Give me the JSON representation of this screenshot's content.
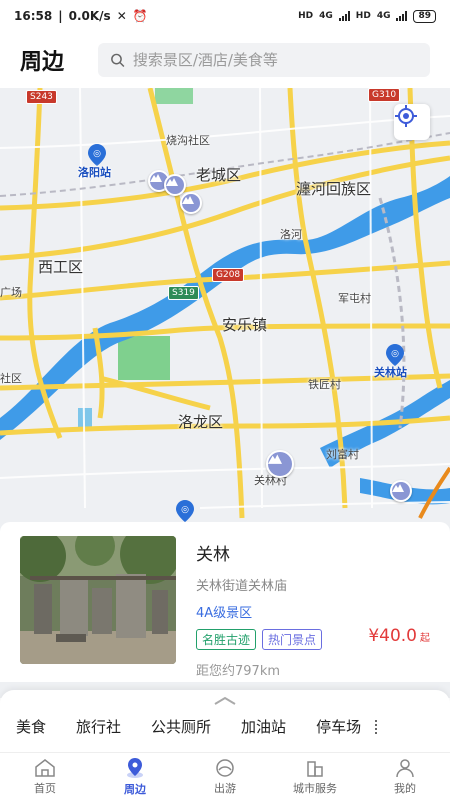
{
  "status": {
    "time": "16:58",
    "net": "0.0K/s",
    "battery": "89",
    "hd1": "HD",
    "hd2": "HD",
    "g1": "4G",
    "g2": "4G"
  },
  "header": {
    "title": "周边",
    "search_placeholder": "搜索景区/酒店/美食等"
  },
  "map": {
    "labels": {
      "laocheng": "老城区",
      "chanhe": "瀍河回族区",
      "xigong": "西工区",
      "anle": "安乐镇",
      "luolong": "洛龙区",
      "shaogou": "烧沟社区",
      "luohe": "洛河",
      "juntun": "军屯村",
      "tiejiang": "铁匠村",
      "liufu": "刘富村",
      "guanlincun": "关林村",
      "she": "社区",
      "chang": "广场"
    },
    "stations": {
      "luoyang": "洛阳站",
      "guanlin": "关林站"
    },
    "roads": {
      "s243": "S243",
      "g310": "G310",
      "g208": "G208",
      "s319": "S319"
    }
  },
  "card": {
    "name": "关林",
    "address": "关林街道关林庙",
    "level": "4A级景区",
    "tags": [
      "名胜古迹",
      "热门景点"
    ],
    "distance": "距您约797km",
    "price": "¥40.0",
    "price_suffix": "起"
  },
  "categories": [
    "美食",
    "旅行社",
    "公共厕所",
    "加油站",
    "停车场"
  ],
  "tabs": [
    {
      "label": "首页",
      "icon": "home-icon"
    },
    {
      "label": "周边",
      "icon": "location-pin-icon"
    },
    {
      "label": "出游",
      "icon": "travel-icon"
    },
    {
      "label": "城市服务",
      "icon": "city-icon"
    },
    {
      "label": "我的",
      "icon": "user-icon"
    }
  ],
  "colors": {
    "accent": "#3d5bd9",
    "river": "#3f9be8",
    "road": "#f6d24a",
    "price": "#e23a3a"
  }
}
